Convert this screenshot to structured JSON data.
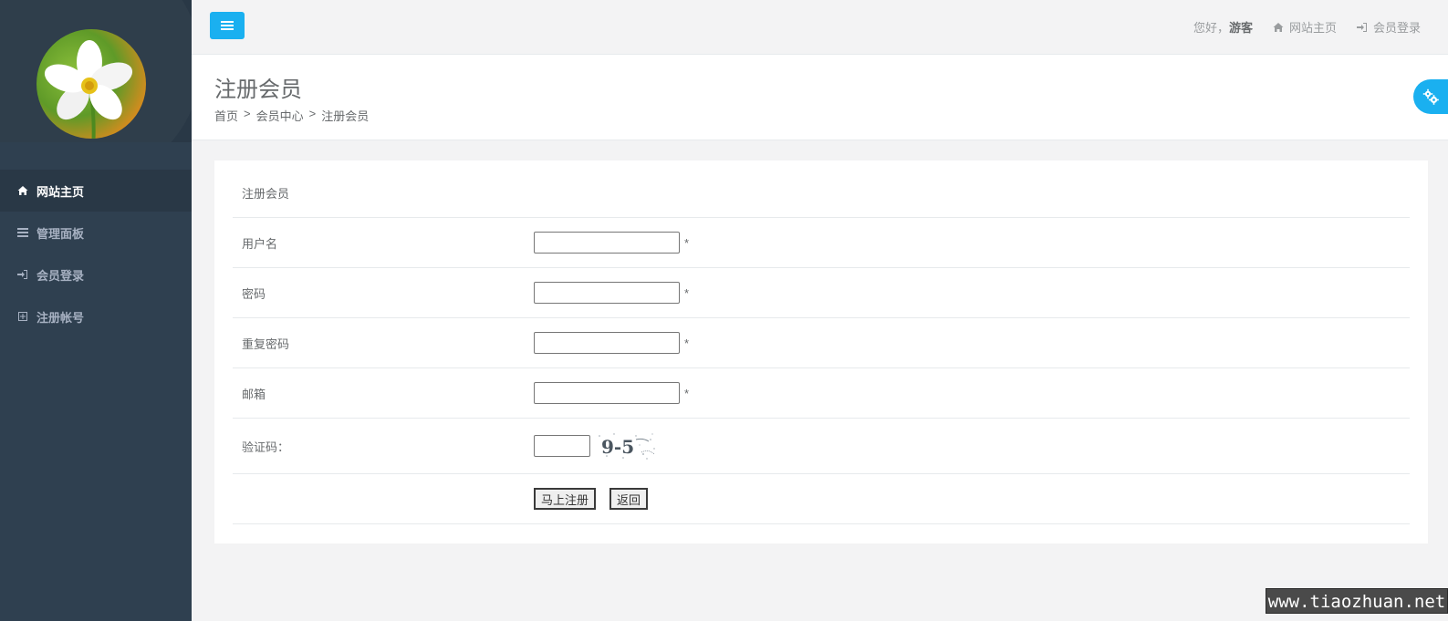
{
  "sidebar": {
    "items": [
      {
        "label": "网站主页",
        "icon": "home-icon",
        "active": true
      },
      {
        "label": "管理面板",
        "icon": "list-icon",
        "active": false
      },
      {
        "label": "会员登录",
        "icon": "sign-in-icon",
        "active": false
      },
      {
        "label": "注册帐号",
        "icon": "plus-square-icon",
        "active": false
      }
    ]
  },
  "topbar": {
    "greeting": "您好，",
    "username": "游客",
    "home_link": "网站主页",
    "login_link": "会员登录"
  },
  "heading": {
    "title": "注册会员",
    "breadcrumb": [
      "首页",
      "会员中心",
      "注册会员"
    ],
    "separator": ">"
  },
  "form": {
    "title": "注册会员",
    "fields": [
      {
        "label": "用户名",
        "value": "",
        "required_mark": "*"
      },
      {
        "label": "密码",
        "value": "",
        "required_mark": "*"
      },
      {
        "label": "重复密码",
        "value": "",
        "required_mark": "*"
      },
      {
        "label": "邮箱",
        "value": "",
        "required_mark": "*"
      }
    ],
    "captcha_label": "验证码：",
    "captcha_text": "9-5",
    "submit_label": "马上注册",
    "back_label": "返回"
  },
  "colors": {
    "accent": "#1ab0f0",
    "sidebar_bg": "#2f4050",
    "sidebar_active_bg": "#293846"
  },
  "watermark": "www.tiaozhuan.net"
}
